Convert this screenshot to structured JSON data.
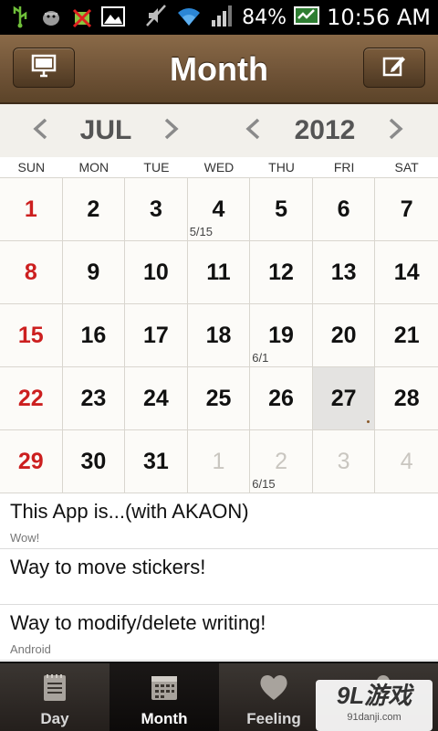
{
  "status_bar": {
    "battery": "84%",
    "time": "10:56 AM",
    "icons": [
      "usb-icon",
      "android-debug-icon",
      "android-blocked-icon",
      "image-icon",
      "mute-icon",
      "wifi-icon",
      "signal-icon",
      "battery-icon"
    ]
  },
  "header": {
    "title": "Month",
    "left_icon": "monitor-icon",
    "right_icon": "edit-icon"
  },
  "selector": {
    "month": "JUL",
    "year": "2012"
  },
  "weekdays": [
    "SUN",
    "MON",
    "TUE",
    "WED",
    "THU",
    "FRI",
    "SAT"
  ],
  "calendar": [
    {
      "day": "1",
      "kind": "sun",
      "note": ""
    },
    {
      "day": "2",
      "kind": "",
      "note": ""
    },
    {
      "day": "3",
      "kind": "",
      "note": ""
    },
    {
      "day": "4",
      "kind": "",
      "note": "5/15"
    },
    {
      "day": "5",
      "kind": "",
      "note": ""
    },
    {
      "day": "6",
      "kind": "",
      "note": ""
    },
    {
      "day": "7",
      "kind": "",
      "note": ""
    },
    {
      "day": "8",
      "kind": "sun",
      "note": ""
    },
    {
      "day": "9",
      "kind": "",
      "note": ""
    },
    {
      "day": "10",
      "kind": "",
      "note": ""
    },
    {
      "day": "11",
      "kind": "",
      "note": ""
    },
    {
      "day": "12",
      "kind": "",
      "note": ""
    },
    {
      "day": "13",
      "kind": "",
      "note": ""
    },
    {
      "day": "14",
      "kind": "",
      "note": ""
    },
    {
      "day": "15",
      "kind": "sun",
      "note": ""
    },
    {
      "day": "16",
      "kind": "",
      "note": ""
    },
    {
      "day": "17",
      "kind": "",
      "note": ""
    },
    {
      "day": "18",
      "kind": "",
      "note": ""
    },
    {
      "day": "19",
      "kind": "",
      "note": "6/1"
    },
    {
      "day": "20",
      "kind": "",
      "note": ""
    },
    {
      "day": "21",
      "kind": "",
      "note": ""
    },
    {
      "day": "22",
      "kind": "sun",
      "note": ""
    },
    {
      "day": "23",
      "kind": "",
      "note": ""
    },
    {
      "day": "24",
      "kind": "",
      "note": ""
    },
    {
      "day": "25",
      "kind": "",
      "note": ""
    },
    {
      "day": "26",
      "kind": "",
      "note": ""
    },
    {
      "day": "27",
      "kind": "today",
      "note": ""
    },
    {
      "day": "28",
      "kind": "",
      "note": ""
    },
    {
      "day": "29",
      "kind": "sun",
      "note": ""
    },
    {
      "day": "30",
      "kind": "",
      "note": ""
    },
    {
      "day": "31",
      "kind": "",
      "note": ""
    },
    {
      "day": "1",
      "kind": "other",
      "note": ""
    },
    {
      "day": "2",
      "kind": "other",
      "note": "6/15"
    },
    {
      "day": "3",
      "kind": "other",
      "note": ""
    },
    {
      "day": "4",
      "kind": "other",
      "note": ""
    }
  ],
  "posts": [
    {
      "title": "This App is...(with AKAON)",
      "sub": "Wow!"
    },
    {
      "title": "Way to move stickers!",
      "sub": ""
    },
    {
      "title": "Way to modify/delete writing!",
      "sub": "Android"
    }
  ],
  "tabs": [
    {
      "label": "Day",
      "icon": "notepad-icon",
      "active": false
    },
    {
      "label": "Month",
      "icon": "calendar-icon",
      "active": true
    },
    {
      "label": "Feeling",
      "icon": "heart-icon",
      "active": false
    },
    {
      "label": "",
      "icon": "person-icon",
      "active": false
    }
  ],
  "watermark": {
    "main": "9L游戏",
    "sub": "91danji.com"
  },
  "colors": {
    "sunday": "#cc1f1f",
    "header_brown": "#6e5236",
    "today_bg": "#e4e3e1"
  }
}
